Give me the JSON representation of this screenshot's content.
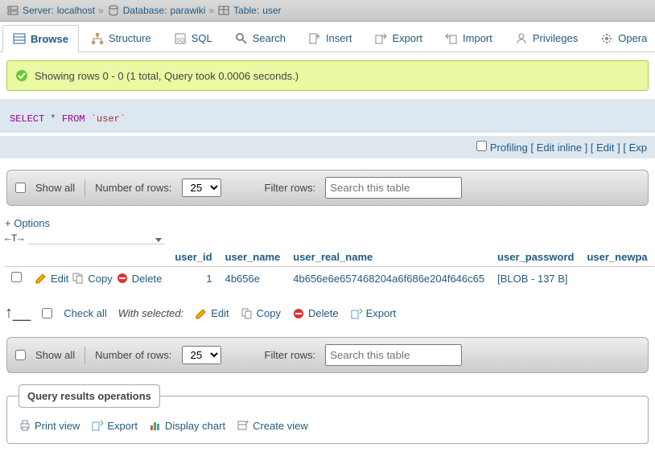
{
  "breadcrumb": {
    "server_lbl": "Server:",
    "server": "localhost",
    "database_lbl": "Database:",
    "database": "parawiki",
    "table_lbl": "Table:",
    "table": "user"
  },
  "tabs": {
    "browse": "Browse",
    "structure": "Structure",
    "sql": "SQL",
    "search": "Search",
    "insert": "Insert",
    "export": "Export",
    "import": "Import",
    "privileges": "Privileges",
    "operations": "Opera"
  },
  "status": {
    "text": "Showing rows 0 - 0 (1 total, Query took 0.0006 seconds.)"
  },
  "sql": {
    "select": "SELECT",
    "star": "*",
    "from": "FROM",
    "table": "`user`",
    "profiling": "Profiling",
    "edit_inline": "Edit inline",
    "edit": "Edit",
    "explain_prefix": "[ Exp"
  },
  "toolbar": {
    "show_all": "Show all",
    "num_rows_lbl": "Number of rows:",
    "num_rows_val": "25",
    "filter_lbl": "Filter rows:",
    "filter_placeholder": "Search this table"
  },
  "options_link": "+ Options",
  "navarrows": "←T→",
  "columns": {
    "user_id": "user_id",
    "user_name": "user_name",
    "user_real_name": "user_real_name",
    "user_password": "user_password",
    "user_newpassword": "user_newpa"
  },
  "row_actions": {
    "edit": "Edit",
    "copy": "Copy",
    "delete": "Delete"
  },
  "row": {
    "user_id": "1",
    "user_name": "4b656e",
    "user_real_name": "4b656e6e657468204a6f686e204f646c65",
    "user_password": "[BLOB - 137 B]"
  },
  "withselected": {
    "check_all": "Check all",
    "label": "With selected:",
    "edit": "Edit",
    "copy": "Copy",
    "delete": "Delete",
    "export": "Export"
  },
  "ops": {
    "legend": "Query results operations",
    "print": "Print view",
    "export": "Export",
    "chart": "Display chart",
    "create_view": "Create view"
  }
}
